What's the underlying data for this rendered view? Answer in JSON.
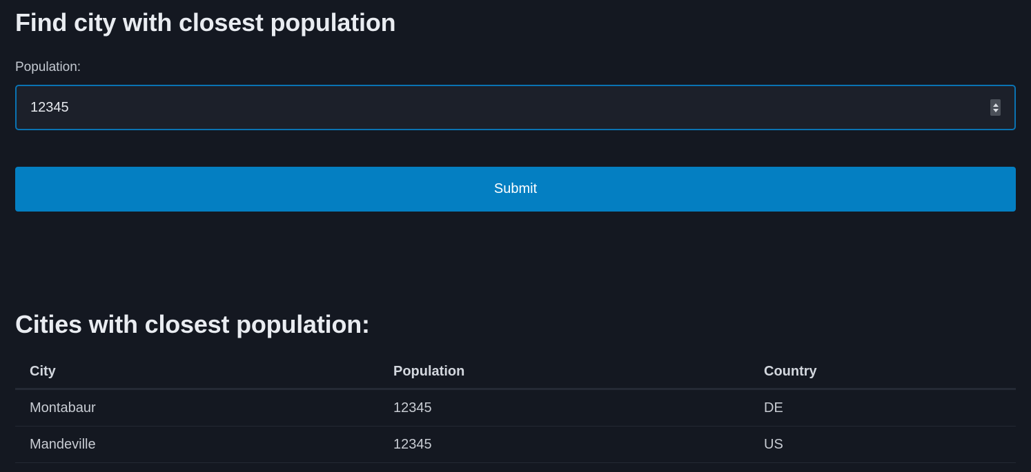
{
  "form": {
    "heading": "Find city with closest population",
    "population_label": "Population:",
    "population_value": "12345",
    "submit_label": "Submit"
  },
  "results": {
    "heading": "Cities with closest population:",
    "columns": [
      "City",
      "Population",
      "Country"
    ],
    "rows": [
      {
        "city": "Montabaur",
        "population": "12345",
        "country": "DE"
      },
      {
        "city": "Mandeville",
        "population": "12345",
        "country": "US"
      }
    ]
  },
  "colors": {
    "background": "#141821",
    "accent": "#047fc2",
    "input_border": "#0a73b3"
  }
}
